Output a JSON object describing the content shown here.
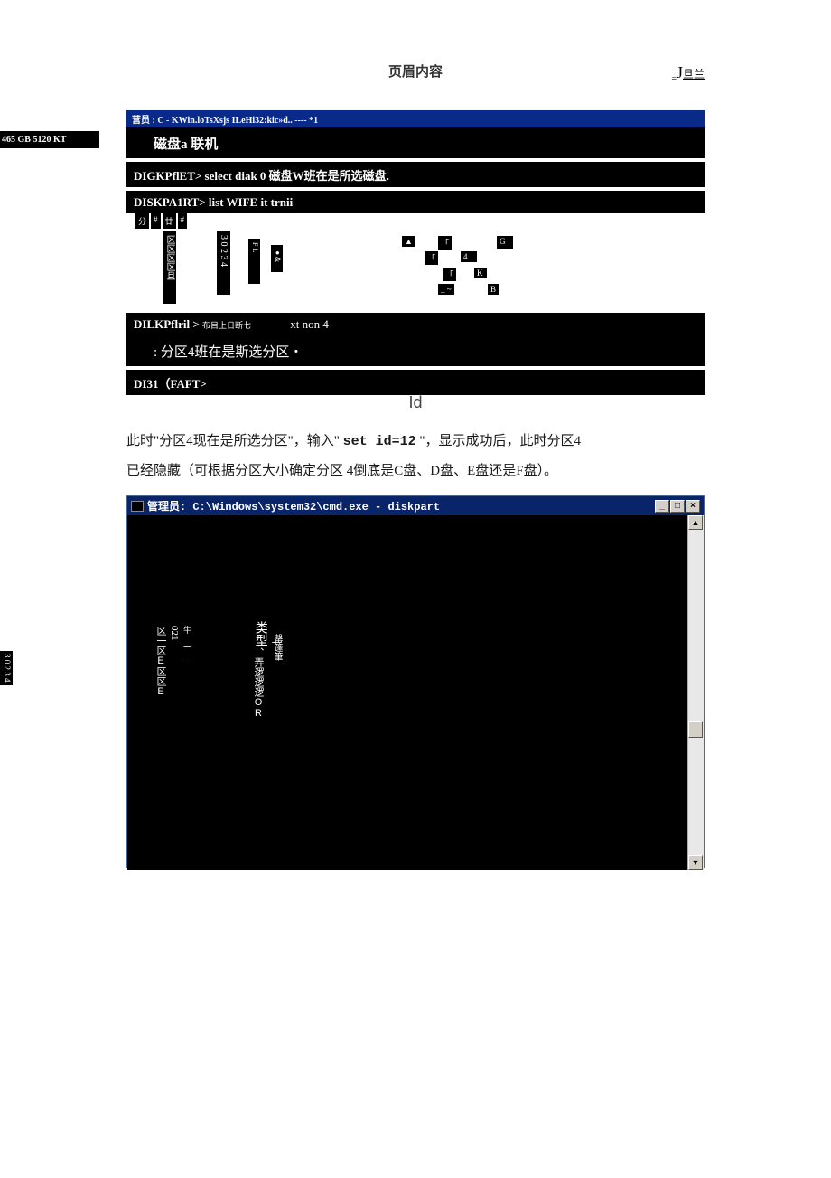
{
  "header": {
    "center": "页眉内容",
    "right_eq": "=",
    "right_main": "J",
    "right_sub": "旦兰"
  },
  "left_strip_top": "465 GB 5120 KT",
  "left_strip_side": "3 0 2 3 4",
  "term1": {
    "titlebar": "营员 : C - KWin.loTsXsjs ILeHi32:kic»d.. ---- *1",
    "row_disk": "磁盘a 联机",
    "row_select": "DIGKPflET> select diak 0 磁盘W班在是所选磁盘.",
    "row_list": "DISKPA1RT> list WIFE it trnii",
    "tabs": [
      "分",
      "#",
      "廿",
      "#"
    ],
    "vcol_a": "区区区区且",
    "vcol_b": "3 0 2 3 4",
    "vcol_c": "F L",
    "vcol_d": "●&",
    "blob_e1": "▲",
    "blob_e2": "「",
    "blob_e3": "G",
    "blob_e4": "「",
    "blob_e5": "4",
    "blob_e6": "「",
    "blob_e7": "K",
    "blob_e8": "_ ~",
    "blob_e9": "B",
    "row_xtnon_a": "DILKPflril >",
    "row_xtnon_b": "布目上日断七",
    "row_xtnon_c": "xt non 4",
    "row_selected": ": 分区4班在是斯选分区・",
    "row_last": "DI31（FAFT>"
  },
  "mid_label": "Id",
  "body_para": {
    "line1_a": "此时\"分区4现在是所选分区\"，输入\" ",
    "line1_mono": "set id=12",
    "line1_b": " \"，显示成功后，此时分区4",
    "line2": "已经隐藏（可根据分区大小确定分区 4倒底是C盘、D盘、E盘还是F盘）。"
  },
  "term2": {
    "title": "管理员: C:\\Windows\\system32\\cmd.exe - diskpart",
    "btn_min": "_",
    "btn_max": "□",
    "btn_close": "×",
    "scroll_up": "▲",
    "scroll_dn": "▼",
    "vgroup1": [
      "区一区E区区E",
      "021",
      "牛 一 一"
    ],
    "vgroup2_a": "类型",
    "vgroup2_b": "一",
    "vgroup2_c": "罄篷筆",
    "vgroup2_d": "、弄逻逻逻OR"
  }
}
